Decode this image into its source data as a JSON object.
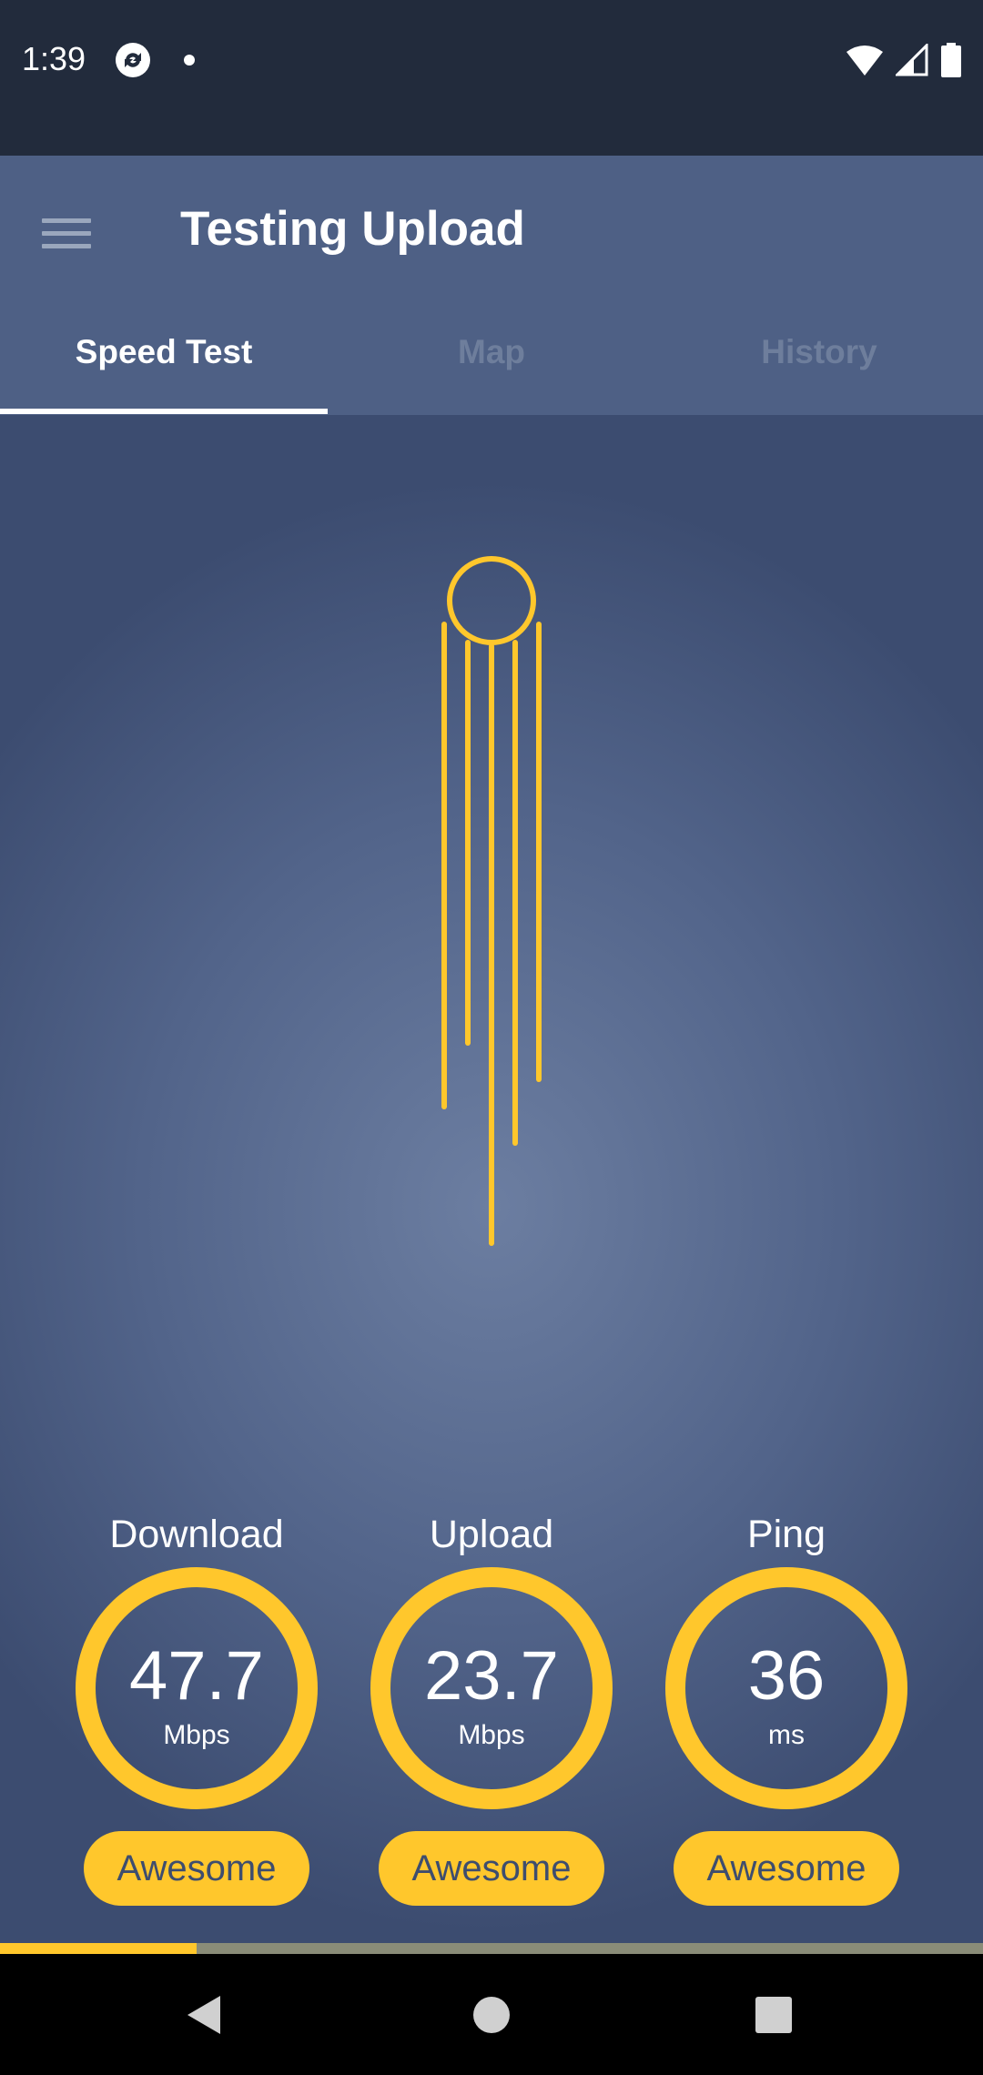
{
  "status_bar": {
    "time": "1:39"
  },
  "app_bar": {
    "title": "Testing Upload"
  },
  "tabs": [
    {
      "label": "Speed Test",
      "active": true
    },
    {
      "label": "Map",
      "active": false
    },
    {
      "label": "History",
      "active": false
    }
  ],
  "metrics": [
    {
      "label": "Download",
      "value": "47.7",
      "unit": "Mbps",
      "rating": "Awesome"
    },
    {
      "label": "Upload",
      "value": "23.7",
      "unit": "Mbps",
      "rating": "Awesome"
    },
    {
      "label": "Ping",
      "value": "36",
      "unit": "ms",
      "rating": "Awesome"
    }
  ],
  "progress": {
    "fraction": 0.2
  },
  "colors": {
    "accent": "#ffc72c",
    "app_bar": "#4e6085",
    "status_bar": "#222b3c"
  },
  "icons": {
    "menu": "menu-icon",
    "rocket": "upload-rocket-icon",
    "back": "back-icon",
    "home": "home-icon",
    "recents": "recents-icon"
  }
}
